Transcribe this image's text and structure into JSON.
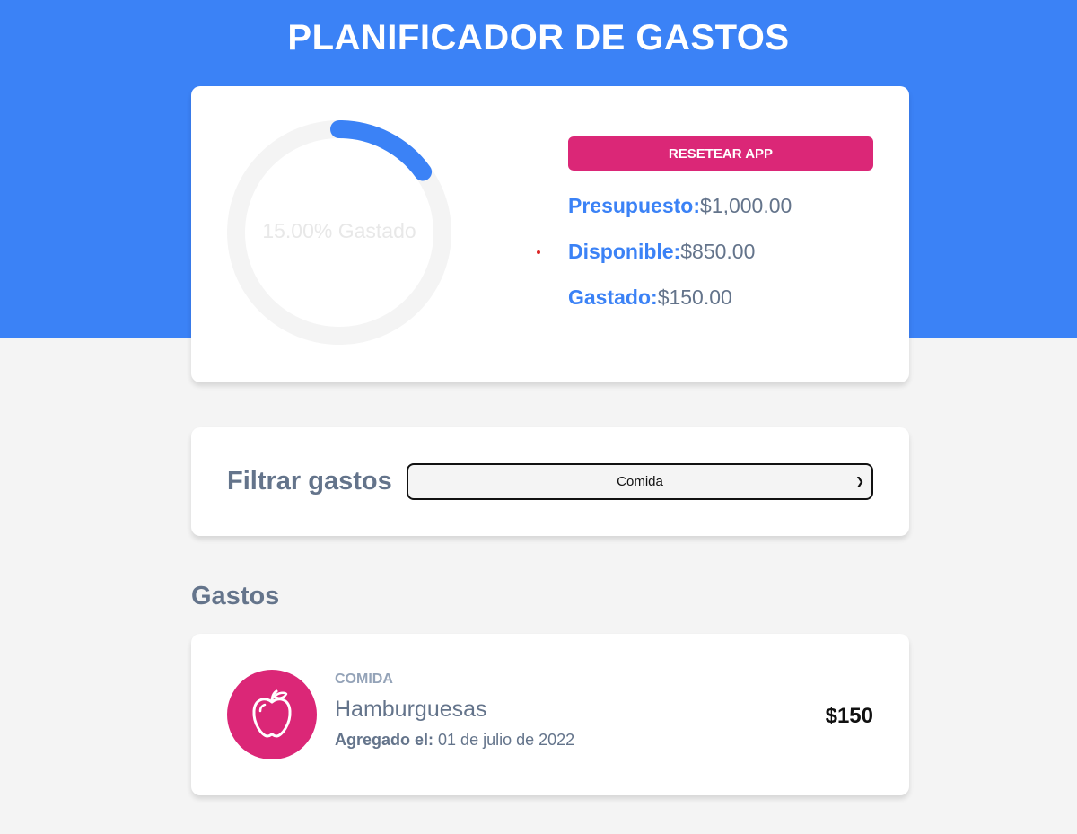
{
  "header": {
    "title": "PLANIFICADOR DE GASTOS"
  },
  "budget": {
    "progress_text": "15.00% Gastado",
    "percent_spent": 15,
    "reset_label": "RESETEAR APP",
    "presupuesto_label": "Presupuesto:",
    "presupuesto_value": "$1,000.00",
    "disponible_label": "Disponible:",
    "disponible_value": "$850.00",
    "gastado_label": "Gastado:",
    "gastado_value": "$150.00"
  },
  "filter": {
    "label": "Filtrar gastos",
    "selected": "Comida"
  },
  "expenses": {
    "title": "Gastos",
    "items": [
      {
        "category": "COMIDA",
        "name": "Hamburguesas",
        "date_label": "Agregado el:",
        "date": "01 de julio de 2022",
        "amount": "$150",
        "icon": "apple-icon"
      }
    ]
  },
  "colors": {
    "primary": "#3b82f6",
    "accent": "#db2777",
    "text": "#64748b",
    "background": "#f4f4f4"
  }
}
